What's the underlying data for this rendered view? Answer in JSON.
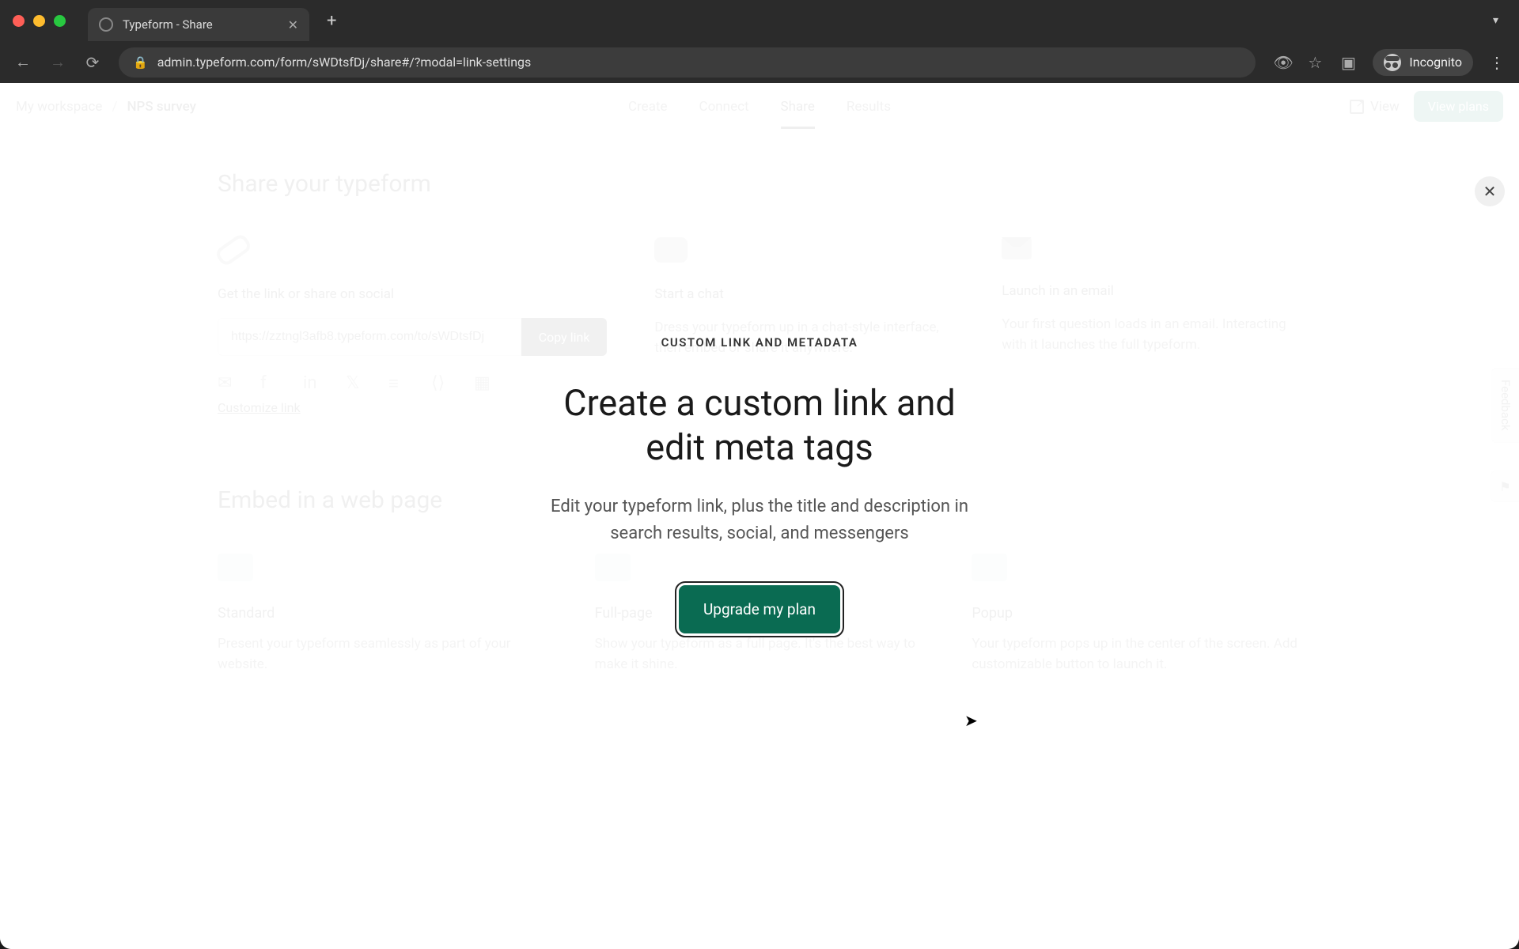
{
  "browser": {
    "tab_title": "Typeform - Share",
    "url_display": "admin.typeform.com/form/sWDtsfDj/share#/?modal=link-settings",
    "incognito_label": "Incognito"
  },
  "header": {
    "breadcrumb_workspace": "My workspace",
    "breadcrumb_sep": "/",
    "breadcrumb_form": "NPS survey",
    "tabs": {
      "create": "Create",
      "connect": "Connect",
      "share": "Share",
      "results": "Results"
    },
    "view_label": "View",
    "view_plans_label": "View plans"
  },
  "share": {
    "title": "Share your typeform",
    "link_card": {
      "title": "Get the link or share on social",
      "url_value": "https://zztngl3afb8.typeform.com/to/sWDtsfDj",
      "copy_label": "Copy link",
      "customize_label": "Customize link"
    },
    "chat_card": {
      "title": "Start a chat",
      "desc": "Dress your typeform up in a chat-style interface, then embed or share it anywhere."
    },
    "email_card": {
      "title": "Launch in an email",
      "desc": "Your first question loads in an email. Interacting with it launches the full typeform."
    },
    "embed_title": "Embed in a web page",
    "embed": {
      "standard": {
        "title": "Standard",
        "desc": "Present your typeform seamlessly as part of your website."
      },
      "fullpage": {
        "title": "Full-page",
        "desc": "Show your typeform as a full page. It's the best way to make it shine."
      },
      "popup": {
        "title": "Popup",
        "desc": "Your typeform pops up in the center of the screen. Add customizable button to launch it."
      }
    }
  },
  "modal": {
    "eyebrow": "CUSTOM LINK AND METADATA",
    "title": "Create a custom link and edit meta tags",
    "desc": "Edit your typeform link, plus the title and description in search results, social, and messengers",
    "cta": "Upgrade my plan"
  },
  "feedback_label": "Feedback"
}
